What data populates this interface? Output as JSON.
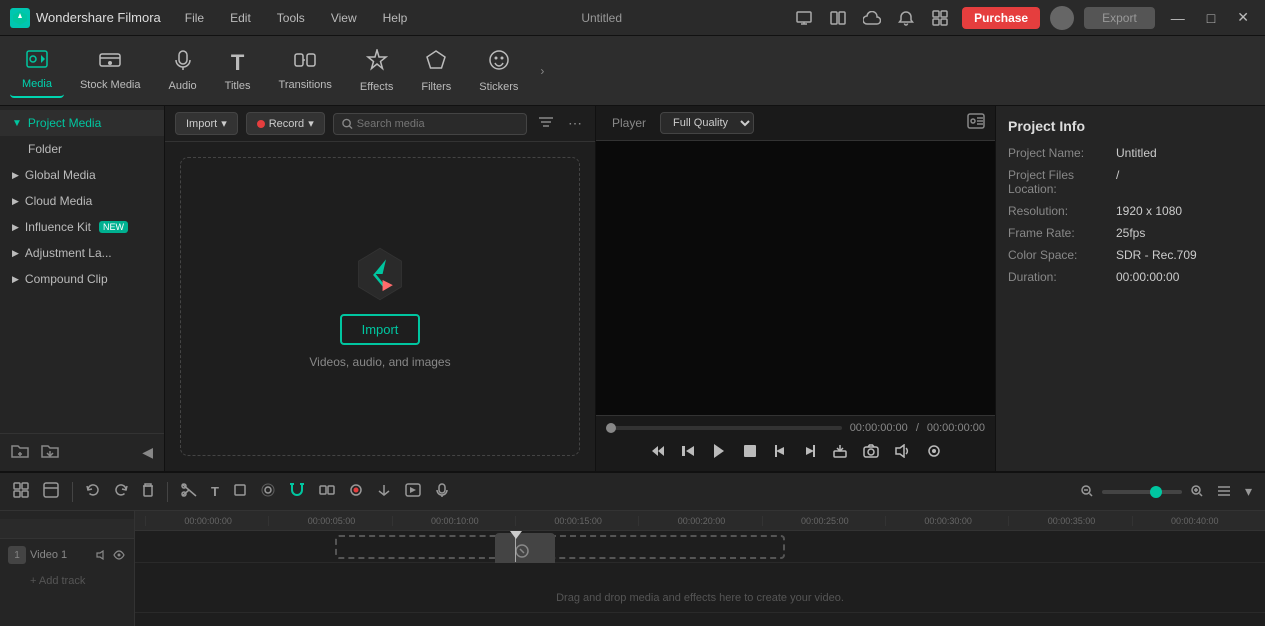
{
  "app": {
    "name": "Wondershare Filmora",
    "title": "Untitled",
    "logo_text": "F"
  },
  "titlebar": {
    "menu": [
      "File",
      "Edit",
      "Tools",
      "View",
      "Help"
    ],
    "purchase_label": "Purchase",
    "export_label": "Export",
    "window_controls": [
      "—",
      "□",
      "✕"
    ]
  },
  "toolbar": {
    "items": [
      {
        "id": "media",
        "label": "Media",
        "icon": "⊞",
        "active": true
      },
      {
        "id": "stock-media",
        "label": "Stock Media",
        "icon": "🎞"
      },
      {
        "id": "audio",
        "label": "Audio",
        "icon": "🎵"
      },
      {
        "id": "titles",
        "label": "Titles",
        "icon": "T"
      },
      {
        "id": "transitions",
        "label": "Transitions",
        "icon": "⧉"
      },
      {
        "id": "effects",
        "label": "Effects",
        "icon": "✦"
      },
      {
        "id": "filters",
        "label": "Filters",
        "icon": "⬡"
      },
      {
        "id": "stickers",
        "label": "Stickers",
        "icon": "★"
      }
    ],
    "more_icon": "›"
  },
  "left_panel": {
    "items": [
      {
        "id": "project-media",
        "label": "Project Media",
        "active": true,
        "indent": false
      },
      {
        "id": "folder",
        "label": "Folder",
        "indent": true
      },
      {
        "id": "global-media",
        "label": "Global Media",
        "indent": false
      },
      {
        "id": "cloud-media",
        "label": "Cloud Media",
        "indent": false
      },
      {
        "id": "influence-kit",
        "label": "Influence Kit",
        "badge": "NEW",
        "indent": false
      },
      {
        "id": "adjustment-la",
        "label": "Adjustment La...",
        "indent": false
      },
      {
        "id": "compound-clip",
        "label": "Compound Clip",
        "indent": false
      }
    ],
    "footer_icons": [
      "➕",
      "🖼"
    ]
  },
  "media_panel": {
    "import_label": "Import",
    "record_label": "Record",
    "search_placeholder": "Search media",
    "import_cta": "Import",
    "import_subtitle": "Videos, audio, and images",
    "more_icon": "⋯",
    "filter_icon": "⚙"
  },
  "preview": {
    "tab_label": "Player",
    "quality_label": "Full Quality",
    "current_time": "00:00:00:00",
    "total_time": "00:00:00:00",
    "controls": [
      "⏮",
      "⏪",
      "⏯",
      "⬜",
      "{",
      "}",
      "⏸",
      "⏹",
      "📷",
      "🔊",
      "⚙"
    ]
  },
  "project_info": {
    "title": "Project Info",
    "fields": [
      {
        "label": "Project Name:",
        "value": "Untitled"
      },
      {
        "label": "Project Files Location:",
        "value": "/"
      },
      {
        "label": "Resolution:",
        "value": "1920 x 1080"
      },
      {
        "label": "Frame Rate:",
        "value": "25fps"
      },
      {
        "label": "Color Space:",
        "value": "SDR - Rec.709"
      },
      {
        "label": "Duration:",
        "value": "00:00:00:00"
      }
    ]
  },
  "timeline": {
    "toolbar_icons": [
      "⊞",
      "⊡",
      "|",
      "↩",
      "↪",
      "🗑",
      "|",
      "✂",
      "T",
      "□",
      "↻",
      "🔒",
      "⏺",
      "⬇",
      "↕",
      "📷",
      "🎬",
      "🎵",
      "⬛"
    ],
    "ruler_marks": [
      "00:00:00:00",
      "00:00:05:00",
      "00:00:10:00",
      "00:00:15:00",
      "00:00:20:00",
      "00:00:25:00",
      "00:00:30:00",
      "00:00:35:00",
      "00:00:40:00"
    ],
    "tracks": [
      {
        "id": "video1",
        "label": "Video 1",
        "icons": [
          "⏫",
          "🔊",
          "👁"
        ]
      }
    ],
    "drag_hint": "Drag and drop media and effects here to create your video.",
    "zoom_label": "zoom"
  },
  "colors": {
    "accent": "#00c6a0",
    "danger": "#e53e3e",
    "bg_dark": "#1e1e1e",
    "bg_medium": "#252525",
    "bg_light": "#2d2d2d",
    "border": "#333333",
    "text_primary": "#cccccc",
    "text_secondary": "#888888"
  }
}
